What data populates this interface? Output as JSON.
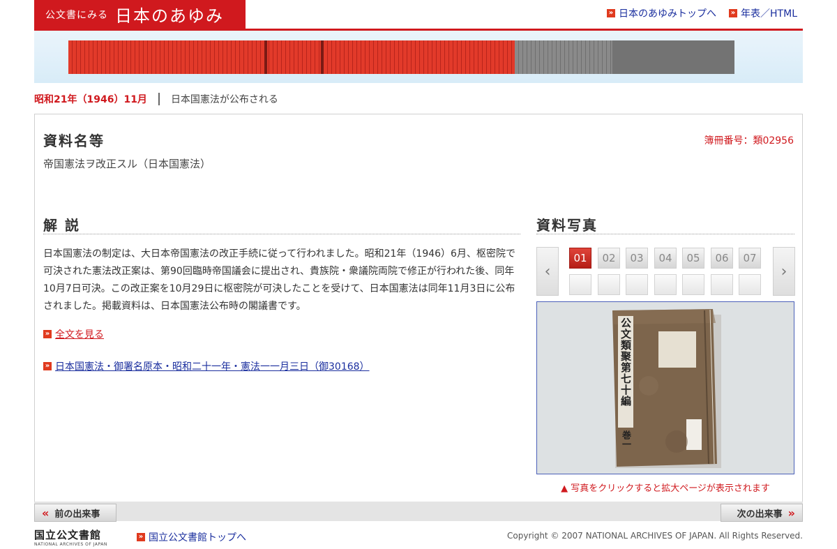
{
  "header": {
    "logo_small": "公文書にみる",
    "logo_big": "日本のあゆみ",
    "links": [
      "日本のあゆみトップへ",
      "年表／HTML"
    ]
  },
  "breadcrumb": {
    "date": "昭和21年（1946）11月",
    "event": "日本国憲法が公布される"
  },
  "document": {
    "section_title": "資料名等",
    "doc_number": "簿冊番号：類02956",
    "name": "帝国憲法ヲ改正スル（日本国憲法）"
  },
  "commentary": {
    "title": "解 説",
    "text": "日本国憲法の制定は、大日本帝国憲法の改正手続に従って行われました。昭和21年（1946）6月、枢密院で可決された憲法改正案は、第90回臨時帝国議会に提出され、貴族院・衆議院両院で修正が行われた後、同年10月7日可決。この改正案を10月29日に枢密院が可決したことを受けて、日本国憲法は同年11月3日に公布されました。掲載資料は、日本国憲法公布時の閣議書です。",
    "link_fulltext": "全文を見る",
    "link_related": "日本国憲法・御署名原本・昭和二十一年・憲法一一月三日（御30168）"
  },
  "photos": {
    "title": "資料写真",
    "pages": [
      "01",
      "02",
      "03",
      "04",
      "05",
      "06",
      "07"
    ],
    "active_page": "01",
    "prev_icon": "chevron-left-icon",
    "next_icon": "chevron-right-icon",
    "caption": "▲ 写真をクリックすると拡大ページが表示されます",
    "book_title": "公文類聚第七十編",
    "book_volume": "巻一"
  },
  "footer": {
    "prev": "前の出来事",
    "next": "次の出来事",
    "archive_jp": "国立公文書館",
    "archive_en": "NATIONAL ARCHIVES OF JAPAN",
    "top_link": "国立公文書館トップへ",
    "copyright": "Copyright © 2007 NATIONAL ARCHIVES OF JAPAN. All Rights Reserved."
  },
  "colors": {
    "accent_red": "#d0191e",
    "link_blue": "#1a2e9e"
  }
}
